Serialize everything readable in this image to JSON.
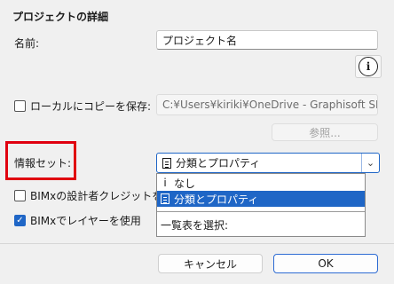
{
  "dialog": {
    "title": "プロジェクトの詳細",
    "name_label": "名前:",
    "name_value": "プロジェクト名",
    "save_local_label": "ローカルにコピーを保存:",
    "save_local_path": "C:¥Users¥kiriki¥OneDrive - Graphisoft SE",
    "browse_label": "参照...",
    "info_set_label": "情報セット:",
    "info_set_value": "分類とプロパティ",
    "bimx_designer_credit_label": "BIMxの設計者クレジットを使用",
    "bimx_layers_label": "BIMxでレイヤーを使用",
    "cancel_label": "キャンセル",
    "ok_label": "OK",
    "info_icon_glyph": "i"
  },
  "dropdown": {
    "items": [
      {
        "icon": "i",
        "label": "なし"
      },
      {
        "icon": "doc-icon",
        "label": "分類とプロパティ"
      }
    ],
    "select_list_label": "一覧表を選択:"
  },
  "colors": {
    "accent": "#1f66c6",
    "highlight_box": "#e0000f"
  }
}
